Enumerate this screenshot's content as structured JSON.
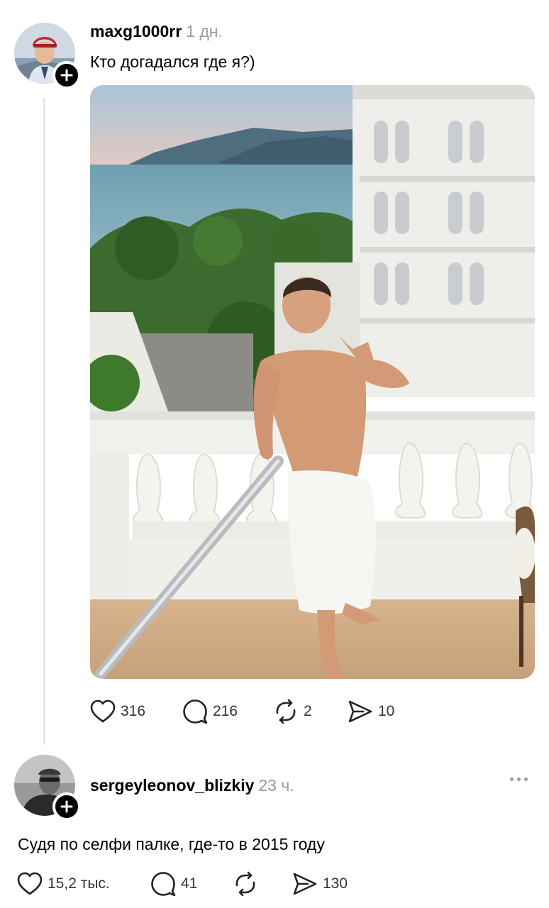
{
  "post": {
    "username": "maxg1000rr",
    "time": "1 дн.",
    "text": "Кто догадался где я?)",
    "stats": {
      "likes": "316",
      "comments": "216",
      "reposts": "2",
      "shares": "10"
    }
  },
  "reply": {
    "username": "sergeyleonov_blizkiy",
    "time": "23 ч.",
    "text": "Судя по селфи палке, где-то в 2015 году",
    "stats": {
      "likes": "15,2 тыс.",
      "comments": "41",
      "reposts": "",
      "shares": "130"
    }
  },
  "icons": [
    "heart-icon",
    "comment-icon",
    "repost-icon",
    "share-icon",
    "plus-icon",
    "more-icon"
  ]
}
